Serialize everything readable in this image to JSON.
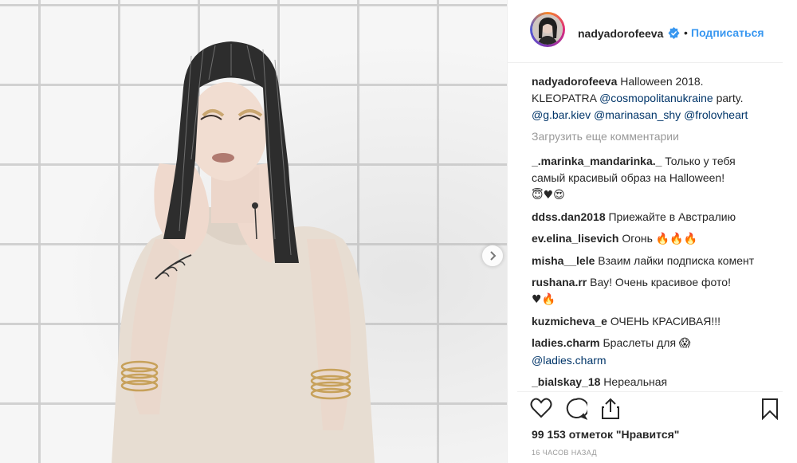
{
  "post": {
    "username": "nadyadorofeeva",
    "follow_label": "Подписаться",
    "dot": "•",
    "caption": {
      "username": "nadyadorofeeva",
      "text": " Halloween 2018. KLEOPATRA ",
      "mention1": "@cosmopolitanukraine",
      "text2": " party. ",
      "mention2": "@g.bar.kiev",
      "mention3": "@marinasan_shy",
      "mention4": "@frolovheart"
    },
    "load_more_label": "Загрузить еще комментарии",
    "comments": [
      {
        "user": "_.marinka_mandarinka._",
        "text": " Только у тебя самый красивый образ на Halloween!",
        "extra": "😇♥😍"
      },
      {
        "user": "ddss.dan2018",
        "text": " Приежайте в Австралию"
      },
      {
        "user": "ev.elina_lisevich",
        "text": " Огонь ",
        "extra": "🔥🔥🔥"
      },
      {
        "user": "misha__lele",
        "text": " Взаим лайки подписка комент"
      },
      {
        "user": "rushana.rr",
        "text": " Вау! Очень красивое фото!",
        "extra": "♥🔥"
      },
      {
        "user": "kuzmicheva_e",
        "text": " ОЧЕНЬ КРАСИВАЯ!!!"
      },
      {
        "user": "ladies.charm",
        "text": " Браслеты для ",
        "extra": "😱",
        "mention": "@ladies.charm"
      },
      {
        "user": "_bialskay_18",
        "text": " Нереальная"
      }
    ],
    "likes_label": "99 153 отметок \"Нравится\"",
    "time_label": "16 часов назад"
  },
  "icons": {
    "like": "heart-icon",
    "comment": "comment-icon",
    "share": "share-icon",
    "save": "bookmark-icon",
    "next": "chevron-right-icon",
    "verified": "verified-badge-icon"
  },
  "colors": {
    "link": "#3897f0",
    "mention": "#003569",
    "muted": "#999999",
    "verified": "#3897f0"
  }
}
